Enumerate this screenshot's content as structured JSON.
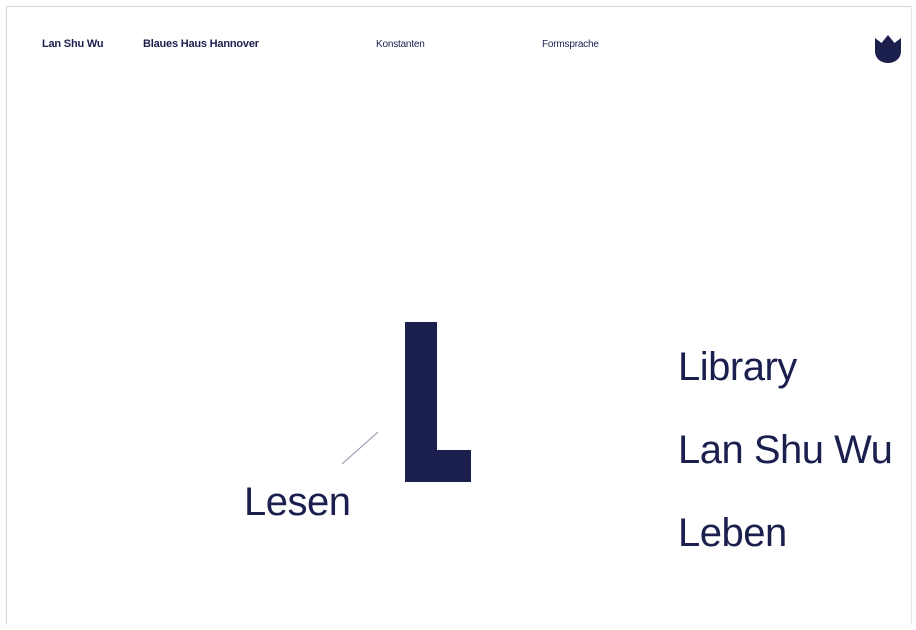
{
  "nav": {
    "brand": "Lan Shu Wu",
    "site": "Blaues Haus Hannover",
    "item_1": "Konstanten",
    "item_2": "Formsprache"
  },
  "logo": {
    "icon": "crown-shield-icon",
    "color": "#1a1f4e"
  },
  "hero": {
    "letter_icon": "letter-L-graphic",
    "left_word": "Lesen",
    "right_words": [
      "Library",
      "Lan Shu Wu",
      "Leben"
    ]
  },
  "colors": {
    "accent": "#1a1f4e",
    "background": "#ffffff"
  }
}
